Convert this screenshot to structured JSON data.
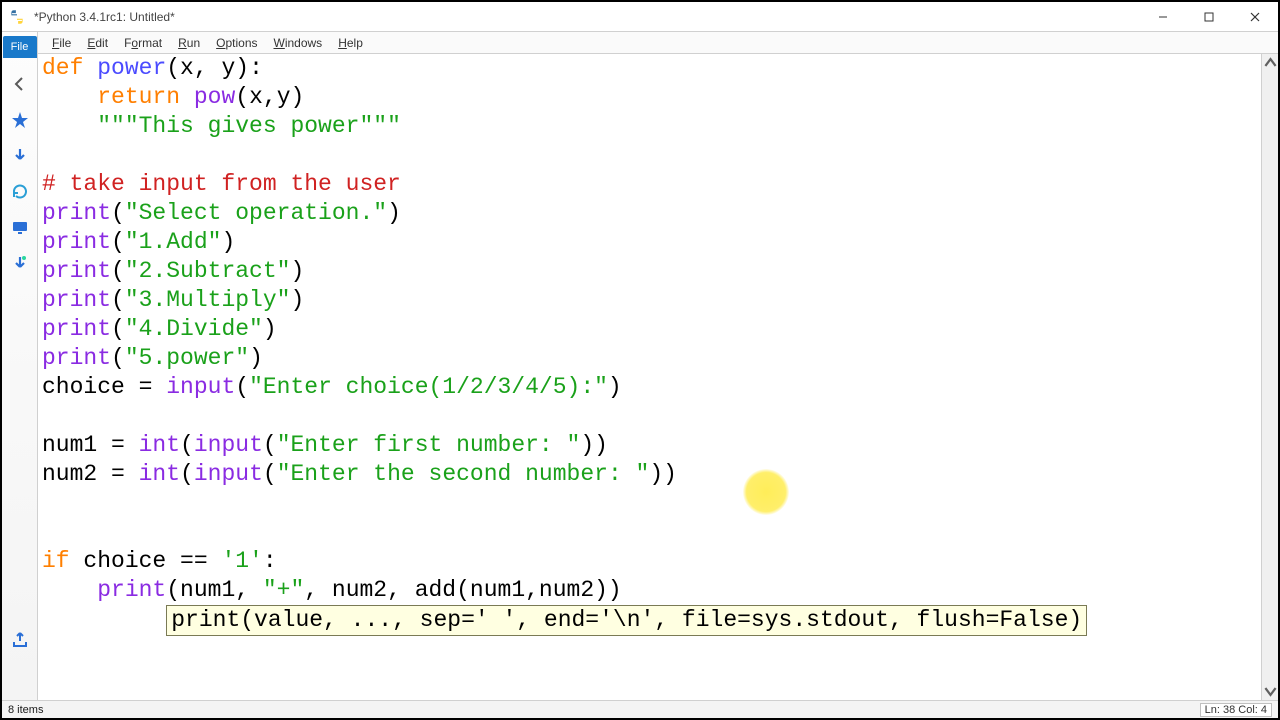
{
  "window": {
    "title": "*Python 3.4.1rc1: Untitled*"
  },
  "file_tab_label": "File",
  "menubar": {
    "items": [
      "File",
      "Edit",
      "Format",
      "Run",
      "Options",
      "Windows",
      "Help"
    ]
  },
  "code": {
    "l1_def": "def",
    "l1_fn": "power",
    "l1_rest": "(x, y):",
    "l2_ret": "return",
    "l2_pow": "pow",
    "l2_rest": "(x,y)",
    "l3_doc": "\"\"\"This gives power\"\"\"",
    "l5_comment": "# take input from the user",
    "print": "print",
    "input": "input",
    "int": "int",
    "l6_str": "\"Select operation.\"",
    "l7_str": "\"1.Add\"",
    "l8_str": "\"2.Subtract\"",
    "l9_str": "\"3.Multiply\"",
    "l10_str": "\"4.Divide\"",
    "l11_str": "\"5.power\"",
    "l12_lhs": "choice = ",
    "l12_str": "\"Enter choice(1/2/3/4/5):\"",
    "l14_lhs": "num1 = ",
    "l14_str": "\"Enter first number: \"",
    "l15_lhs": "num2 = ",
    "l15_str": "\"Enter the second number: \"",
    "l18_if": "if",
    "l18_rest": " choice == ",
    "l18_str": "'1'",
    "l18_colon": ":",
    "l19_args1": "(num1, ",
    "l19_str": "\"+\"",
    "l19_args2": ", num2, add(num1,num2))",
    "tooltip": "print(value, ..., sep=' ', end='\\n', file=sys.stdout, flush=False)"
  },
  "status": {
    "left": "8 items",
    "right": "Ln: 38 Col: 4"
  },
  "icons": {
    "back": "back-arrow-icon",
    "star": "favorite-star-icon",
    "down1": "download-arrow-icon",
    "refresh": "refresh-icon",
    "screen": "screen-icon",
    "downmusic": "music-download-icon",
    "export": "export-icon"
  }
}
